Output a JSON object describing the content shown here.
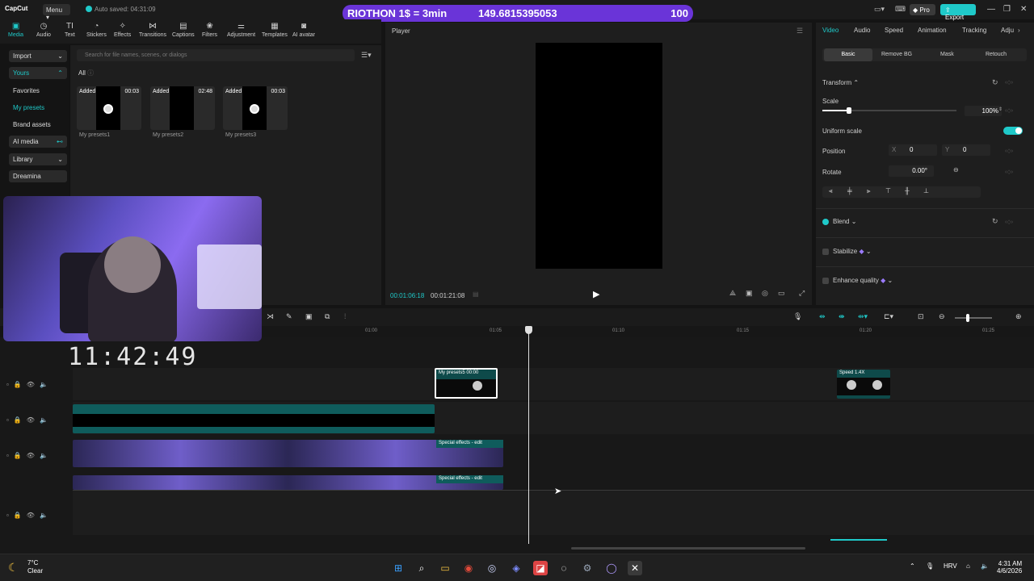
{
  "app": {
    "logo": "CapCut",
    "menu": "Menu",
    "autosave": "Auto saved: 04:31:09",
    "pro_label": "Pro",
    "export_label": "Export",
    "window_controls": [
      "—",
      "❐",
      "✕"
    ]
  },
  "overlay": {
    "left_text": "RIOTHON 1$ = 3min",
    "mid_text": "149.6815395053",
    "right_text": "100"
  },
  "tools": [
    {
      "label": "Media",
      "icon": "media-icon",
      "active": true
    },
    {
      "label": "Audio",
      "icon": "audio-icon"
    },
    {
      "label": "Text",
      "icon": "text-icon"
    },
    {
      "label": "Stickers",
      "icon": "stickers-icon"
    },
    {
      "label": "Effects",
      "icon": "effects-icon"
    },
    {
      "label": "Transitions",
      "icon": "transitions-icon"
    },
    {
      "label": "Captions",
      "icon": "captions-icon"
    },
    {
      "label": "Filters",
      "icon": "filters-icon"
    },
    {
      "label": "Adjustment",
      "icon": "adjustment-icon"
    },
    {
      "label": "Templates",
      "icon": "templates-icon"
    },
    {
      "label": "AI avatar",
      "icon": "ai-avatar-icon"
    }
  ],
  "leftnav": {
    "import": "Import",
    "yours": "Yours",
    "favorites": "Favorites",
    "my_presets": "My presets",
    "brand_assets": "Brand assets",
    "ai_media": "AI media",
    "library": "Library",
    "dreamina": "Dreamina"
  },
  "media": {
    "search_placeholder": "Search for file names, scenes, or dialogs",
    "filter_all": "All",
    "items": [
      {
        "added": "Added",
        "duration": "00:03",
        "name": "My presets1"
      },
      {
        "added": "Added",
        "duration": "02:48",
        "name": "My presets2"
      },
      {
        "added": "Added",
        "duration": "00:03",
        "name": "My presets3"
      }
    ]
  },
  "overlay_clock": "11:42:49",
  "player": {
    "title": "Player",
    "current_time": "00:01:06:18",
    "total_time": "00:01:21:08"
  },
  "inspector": {
    "tabs": [
      "Video",
      "Audio",
      "Speed",
      "Animation",
      "Tracking",
      "Adju"
    ],
    "subtabs": [
      "Basic",
      "Remove BG",
      "Mask",
      "Retouch"
    ],
    "transform": "Transform",
    "scale_label": "Scale",
    "scale_value": "100%",
    "scale_level": 0.2,
    "uniform_scale": "Uniform scale",
    "position_label": "Position",
    "pos_x_label": "X",
    "pos_x": "0",
    "pos_y_label": "Y",
    "pos_y": "0",
    "rotate_label": "Rotate",
    "rotate_value": "0.00°",
    "blend": "Blend",
    "stabilize": "Stabilize",
    "enhance_quality": "Enhance quality"
  },
  "timeline": {
    "ticks": [
      "01:00",
      "01:05",
      "01:10",
      "01:15",
      "01:20",
      "01:25"
    ],
    "clips": {
      "preset_clip": "My presets5  00:00",
      "speed_clip": "Speed 1.4X",
      "fx1": "Special effects - edit",
      "fx2": "Special effects - edit"
    }
  },
  "taskbar": {
    "temp": "7°C",
    "weather": "Clear",
    "lang": "HRV",
    "time": "4:31 AM",
    "date": "4/6/2026"
  }
}
